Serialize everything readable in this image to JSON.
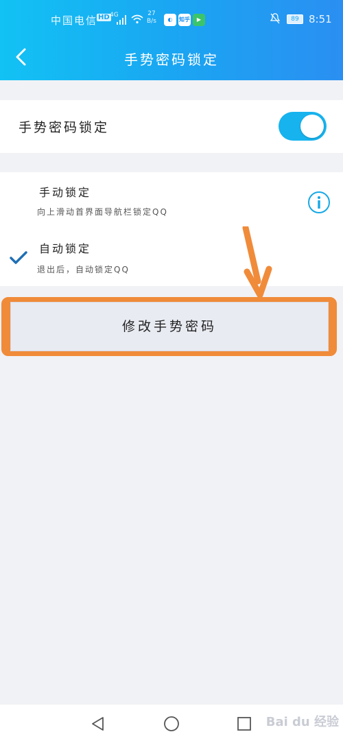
{
  "status_bar": {
    "carrier": "中国电信",
    "hd": "HD",
    "network": "4G",
    "speed_value": "27",
    "speed_unit": "B/s",
    "app_badge_2": "知乎",
    "battery": "89",
    "time": "8:51"
  },
  "nav": {
    "title": "手势密码锁定"
  },
  "toggle_row": {
    "label": "手势密码锁定",
    "enabled": true
  },
  "lock_options": [
    {
      "title": "手动锁定",
      "desc": "向上滑动首界面导航栏锁定QQ",
      "selected": false
    },
    {
      "title": "自动锁定",
      "desc": "退出后，自动锁定QQ",
      "selected": true
    }
  ],
  "modify_button": {
    "label": "修改手势密码"
  },
  "colors": {
    "accent": "#16b3ee",
    "highlight": "#f08b3a",
    "check": "#1f6fb5"
  },
  "watermark": "Bai du 经验"
}
